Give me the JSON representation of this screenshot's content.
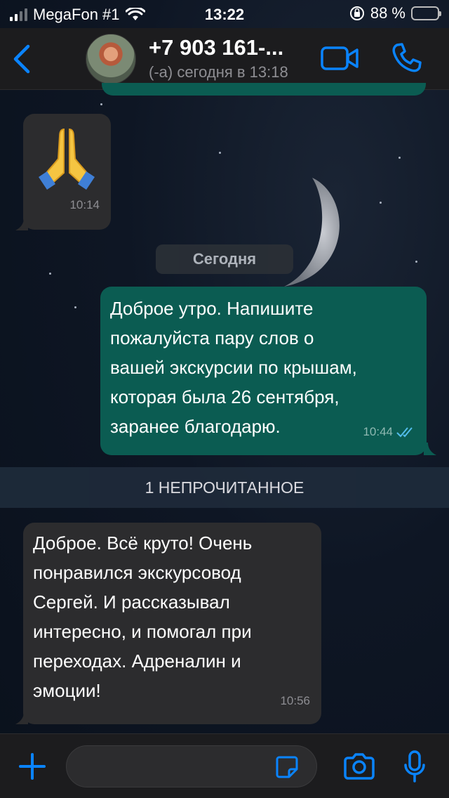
{
  "status_bar": {
    "carrier": "MegaFon #1",
    "time": "13:22",
    "battery_percent": "88 %",
    "battery_level": 0.88
  },
  "header": {
    "contact_name": "+7 903 161-...",
    "contact_status": "(-а) сегодня в 13:18"
  },
  "messages": {
    "emoji_msg": {
      "emoji": "praying-hands-icon",
      "time": "10:14"
    },
    "date_separator": "Сегодня",
    "outgoing": {
      "lines": [
        "Доброе утро. Напишите",
        "пожалуйста пару слов о",
        "вашей экскурсии по крышам,",
        "которая была 26 сентября,",
        "заранее благодарю."
      ],
      "time": "10:44"
    },
    "unread_banner": "1 НЕПРОЧИТАННОЕ",
    "incoming": {
      "lines": [
        "Доброе. Всё круто! Очень",
        "понравился экскурсовод",
        "Сергей. И рассказывал",
        "интересно, и помогал при",
        "переходах. Адреналин и",
        "эмоции!"
      ],
      "time": "10:56"
    }
  },
  "input": {
    "value": "",
    "placeholder": ""
  },
  "colors": {
    "accent": "#0a84ff",
    "outgoing_bubble": "#0b5c52",
    "incoming_bubble": "#2c2c2e",
    "read_ticks": "#53bdeb",
    "battery": "#f6d21a"
  }
}
